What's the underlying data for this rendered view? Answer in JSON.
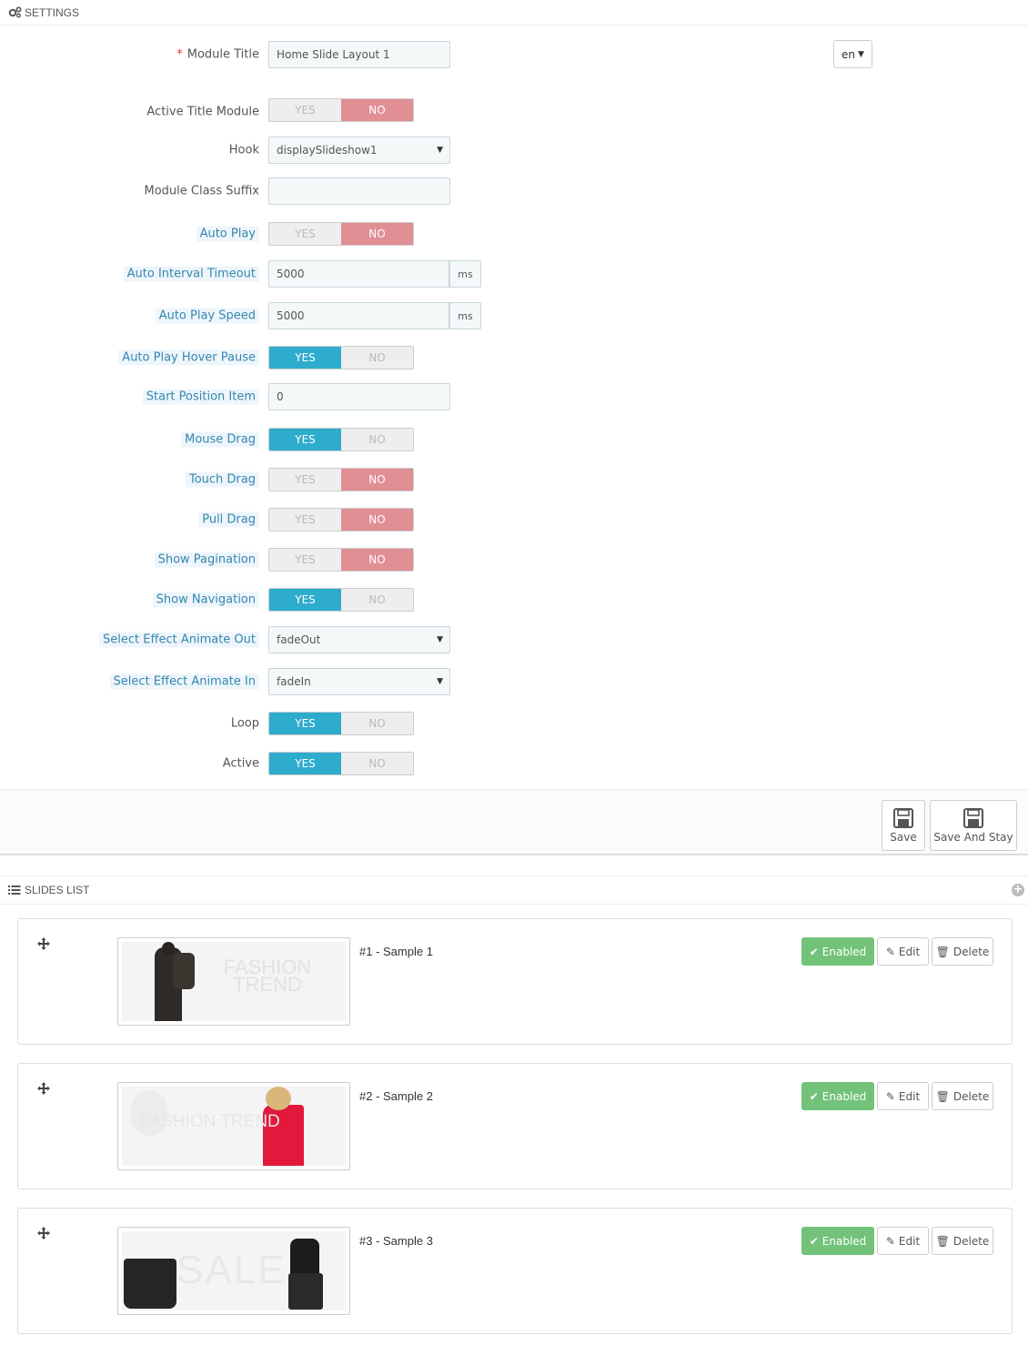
{
  "settings": {
    "heading": "SETTINGS",
    "language": "en",
    "fields": {
      "module_title": {
        "label": "Module Title",
        "required": "*",
        "value": "Home Slide Layout 1"
      },
      "active_title_module": {
        "label": "Active Title Module",
        "value": "NO"
      },
      "hook": {
        "label": "Hook",
        "value": "displaySlideshow1"
      },
      "module_class_suffix": {
        "label": "Module Class Suffix",
        "value": ""
      },
      "auto_play": {
        "label": "Auto Play",
        "value": "NO"
      },
      "auto_interval_timeout": {
        "label": "Auto Interval Timeout",
        "value": "5000",
        "unit": "ms"
      },
      "auto_play_speed": {
        "label": "Auto Play Speed",
        "value": "5000",
        "unit": "ms"
      },
      "auto_play_hover_pause": {
        "label": "Auto Play Hover Pause",
        "value": "YES"
      },
      "start_position_item": {
        "label": "Start Position Item",
        "value": "0"
      },
      "mouse_drag": {
        "label": "Mouse Drag",
        "value": "YES"
      },
      "touch_drag": {
        "label": "Touch Drag",
        "value": "NO"
      },
      "pull_drag": {
        "label": "Pull Drag",
        "value": "NO"
      },
      "show_pagination": {
        "label": "Show Pagination",
        "value": "NO"
      },
      "show_navigation": {
        "label": "Show Navigation",
        "value": "YES"
      },
      "animate_out": {
        "label": "Select Effect Animate Out",
        "value": "fadeOut"
      },
      "animate_in": {
        "label": "Select Effect Animate In",
        "value": "fadeIn"
      },
      "loop": {
        "label": "Loop",
        "value": "YES"
      },
      "active": {
        "label": "Active",
        "value": "YES"
      }
    },
    "switch": {
      "yes": "YES",
      "no": "NO"
    },
    "save_label": "Save",
    "save_stay_label": "Save And Stay"
  },
  "slides_list": {
    "heading": "SLIDES LIST",
    "add_icon": "plus-circle-icon",
    "items": [
      {
        "title": "#1 - Sample 1",
        "status": "Enabled",
        "edit": "Edit",
        "delete": "Delete",
        "art_text": "FASHION TREND"
      },
      {
        "title": "#2 - Sample 2",
        "status": "Enabled",
        "edit": "Edit",
        "delete": "Delete",
        "art_text": "FASHION TREND"
      },
      {
        "title": "#3 - Sample 3",
        "status": "Enabled",
        "edit": "Edit",
        "delete": "Delete",
        "art_text": "SALE"
      }
    ]
  },
  "colors": {
    "yes": "#2eacce",
    "no": "#e08f95",
    "enabled": "#72c279",
    "help_label": "#3586ae"
  }
}
